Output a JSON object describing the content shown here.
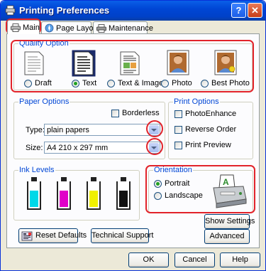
{
  "window": {
    "title": "Printing Preferences",
    "help_btn": "?",
    "close_btn": "✕"
  },
  "tabs": [
    "Main",
    "Page Layout",
    "Maintenance"
  ],
  "quality": {
    "title": "Quality Option",
    "options": [
      "Draft",
      "Text",
      "Text & Image",
      "Photo",
      "Best Photo"
    ],
    "selected": "Text"
  },
  "paper": {
    "title": "Paper Options",
    "borderless": "Borderless",
    "type_label": "Type:",
    "type_value": "plain papers",
    "size_label": "Size:",
    "size_value": "A4 210 x 297 mm"
  },
  "print_options": {
    "title": "Print Options",
    "items": [
      "PhotoEnhance",
      "Reverse Order",
      "Print Preview"
    ]
  },
  "ink": {
    "title": "Ink Levels",
    "colors": [
      "#00d8e8",
      "#e000c8",
      "#f0f000",
      "#111111"
    ],
    "levels": [
      0.65,
      0.65,
      0.65,
      0.65
    ]
  },
  "orientation": {
    "title": "Orientation",
    "options": [
      "Portrait",
      "Landscape"
    ],
    "selected": "Portrait"
  },
  "buttons": {
    "show_settings": "Show Settings",
    "reset_defaults": "Reset Defaults",
    "technical_support": "Technical Support",
    "advanced": "Advanced",
    "ok": "OK",
    "cancel": "Cancel",
    "help": "Help"
  }
}
